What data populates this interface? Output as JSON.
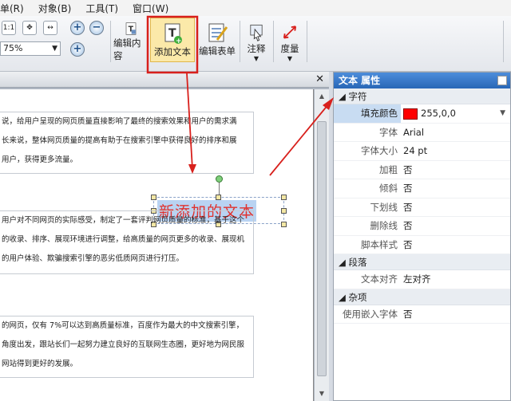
{
  "menu": [
    "单(R)",
    "对象(B)",
    "工具(T)",
    "窗口(W)"
  ],
  "toolbar": {
    "zoom_value": "75%",
    "page_icon_label": "1:1",
    "buttons": [
      {
        "label": "编辑内容"
      },
      {
        "label": "添加文本"
      },
      {
        "label": "编辑表单"
      },
      {
        "label": "注释"
      },
      {
        "label": "度量"
      }
    ]
  },
  "document": {
    "paragraphs": [
      {
        "lines": [
          "说，给用户呈现的网页质量直接影响了最终的搜索效果和用户的需求满",
          "长来说，整体网页质量的提高有助于在搜索引擎中获得良好的排序和展",
          "用户，获得更多流量。"
        ]
      },
      {
        "lines": [
          "用户对不同网页的实际感受，制定了一套评判网页质量的标准，基于这个",
          "的收录、排序、展现环境进行调整，给高质量的网页更多的收录、展现机",
          "的用户体验、欺骗搜索引擎的恶劣低质网页进行打压。"
        ]
      },
      {
        "lines": [
          "的网页，仅有 7%可以达到高质量标准，百度作为最大的中文搜索引擎，",
          "角度出发，跟站长们一起努力建立良好的互联网生态圈，更好地为网民服",
          "网站得到更好的发展。"
        ]
      }
    ],
    "new_text": "新添加的文本"
  },
  "properties": {
    "title": "文本 属性",
    "sections": [
      {
        "name": "字符",
        "rows": [
          {
            "key": "填充颜色",
            "value": "255,0,0",
            "selected": true
          },
          {
            "key": "字体",
            "value": "Arial"
          },
          {
            "key": "字体大小",
            "value": "24 pt"
          },
          {
            "key": "加粗",
            "value": "否"
          },
          {
            "key": "倾斜",
            "value": "否"
          },
          {
            "key": "下划线",
            "value": "否"
          },
          {
            "key": "删除线",
            "value": "否"
          },
          {
            "key": "脚本样式",
            "value": "否"
          }
        ]
      },
      {
        "name": "段落",
        "rows": [
          {
            "key": "文本对齐",
            "value": "左对齐"
          }
        ]
      },
      {
        "name": "杂项",
        "rows": [
          {
            "key": "使用嵌入字体",
            "value": "否"
          }
        ]
      }
    ]
  },
  "colors": {
    "accent_red": "#d8201c",
    "fill_color": "#ff0000",
    "panel_header": "#2f6fc0"
  }
}
